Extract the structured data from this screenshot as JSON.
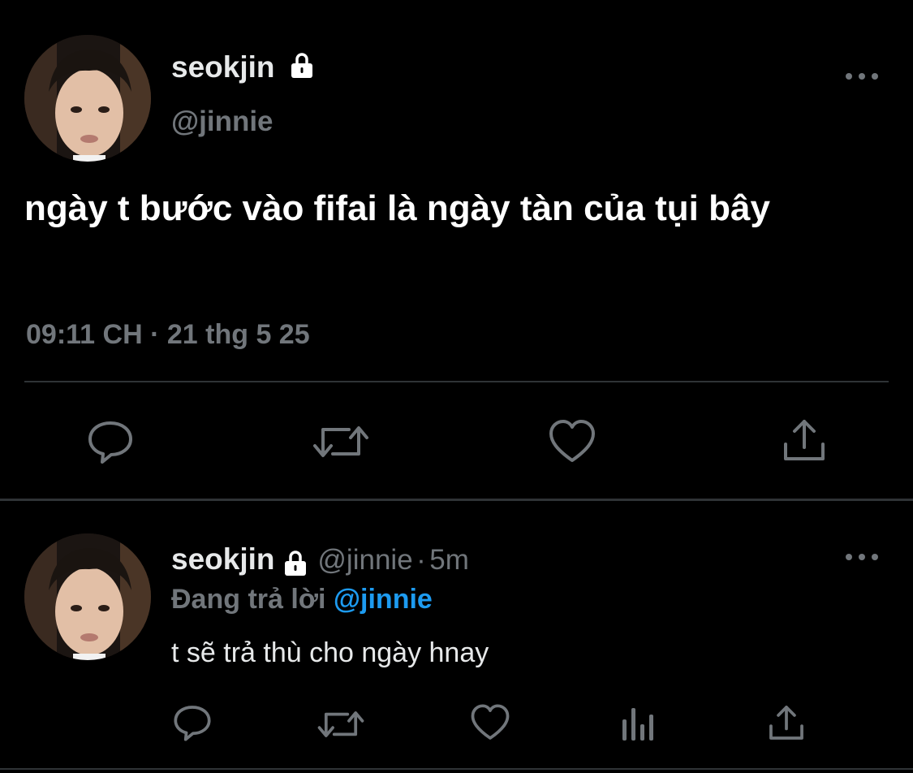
{
  "colors": {
    "background": "#000000",
    "primary_text": "#e7e9ea",
    "secondary_text": "#71767b",
    "link": "#1d9bf0",
    "divider": "#2f3336"
  },
  "main_tweet": {
    "display_name": "seokjin",
    "handle": "@jinnie",
    "protected_icon": "lock-icon",
    "text": "ngày t bước vào fifai là ngày tàn của tụi bây",
    "time": "09:11 CH",
    "separator": "·",
    "date": "21 thg 5 25",
    "actions": [
      "reply-icon",
      "retweet-icon",
      "like-icon",
      "share-icon"
    ]
  },
  "reply_tweet": {
    "display_name": "seokjin",
    "handle": "@jinnie",
    "separator": "·",
    "age": "5m",
    "protected_icon": "lock-icon",
    "replying_prefix": "Đang trả lời",
    "replying_to": "@jinnie",
    "text": "t sẽ trả thù cho ngày hnay",
    "actions": [
      "reply-icon",
      "retweet-icon",
      "like-icon",
      "analytics-icon",
      "share-icon"
    ]
  }
}
